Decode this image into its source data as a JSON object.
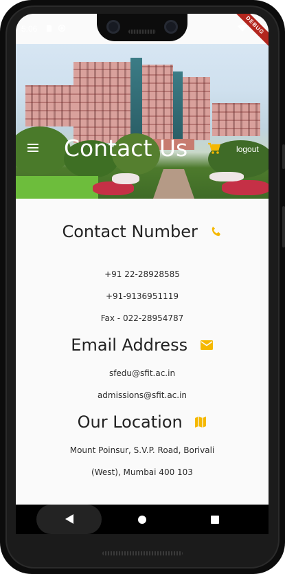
{
  "status_bar": {
    "time": "5:06",
    "debug_label": "DEBUG"
  },
  "app_bar": {
    "title": "Contact Us",
    "logout_label": "logout",
    "menu_icon": "menu-icon",
    "cart_icon": "cart-icon"
  },
  "sections": {
    "contact": {
      "title": "Contact Number",
      "icon": "phone-icon",
      "lines": [
        "+91 22-28928585",
        "+91-9136951119",
        "Fax - 022-28954787"
      ]
    },
    "email": {
      "title": "Email Address",
      "icon": "email-icon",
      "lines": [
        "sfedu@sfit.ac.in",
        "admissions@sfit.ac.in"
      ]
    },
    "location": {
      "title": "Our Location",
      "icon": "map-icon",
      "lines": [
        "Mount Poinsur, S.V.P. Road, Borivali",
        "(West), Mumbai 400 103"
      ]
    }
  },
  "colors": {
    "accent": "#f5b800",
    "appbar_text": "#ffffff",
    "body_text": "#222222"
  }
}
